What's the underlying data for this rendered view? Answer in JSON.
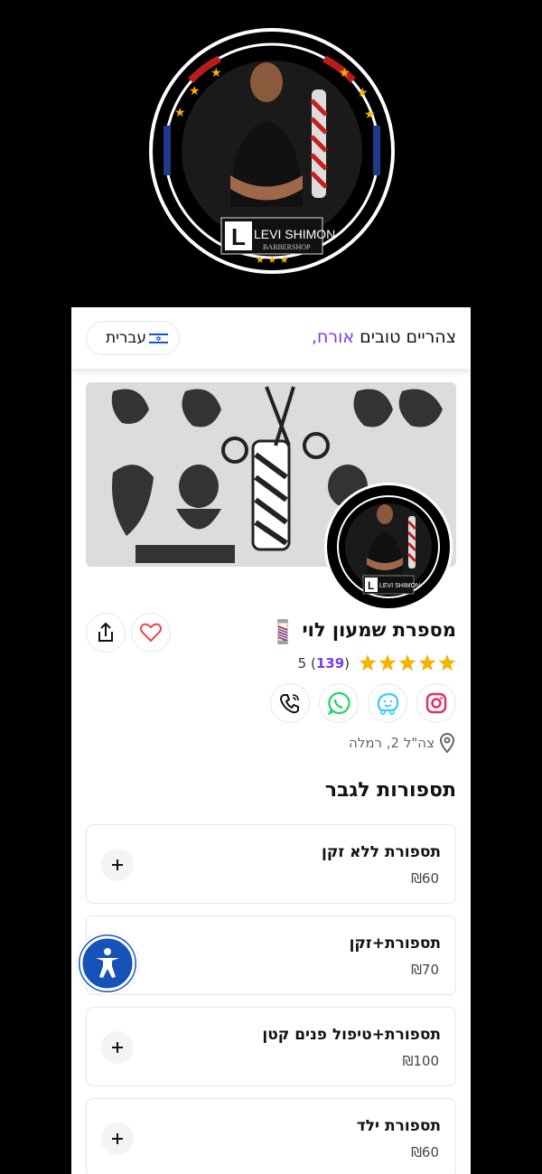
{
  "brand": {
    "logo_line1": "LEVI SHIMON",
    "logo_line2": "BARBERSHOP"
  },
  "header": {
    "greeting_prefix": "צהריים טובים",
    "greeting_name": "אורח,",
    "language_label": "עברית"
  },
  "shop": {
    "name": "מספרת שמעון לוי",
    "rating": "5",
    "reviews_count": "139",
    "rating_fraction": 1.0,
    "address": "צה\"ל 2, רמלה"
  },
  "section": {
    "title": "תספורות לגבר"
  },
  "services": [
    {
      "name": "תספורת ללא זקן",
      "price": "₪60"
    },
    {
      "name": "תספורת+זקן",
      "price": "₪70"
    },
    {
      "name": "תספורת+טיפול פנים קטן",
      "price": "₪100"
    },
    {
      "name": "תספורת ילד",
      "price": "₪60"
    }
  ],
  "icons": {
    "share": "share-icon",
    "favorite": "heart-icon",
    "phone": "phone-icon",
    "whatsapp": "whatsapp-icon",
    "waze": "waze-icon",
    "instagram": "instagram-icon",
    "location": "location-pin-icon",
    "add": "plus-icon",
    "accessibility": "accessibility-icon"
  },
  "colors": {
    "accent": "#7c3aed",
    "heart": "#ef4444",
    "star": "#f5b301",
    "whatsapp": "#25d366",
    "waze": "#33ccff",
    "instagram": "#e1306c",
    "accessibility": "#1652b8"
  }
}
